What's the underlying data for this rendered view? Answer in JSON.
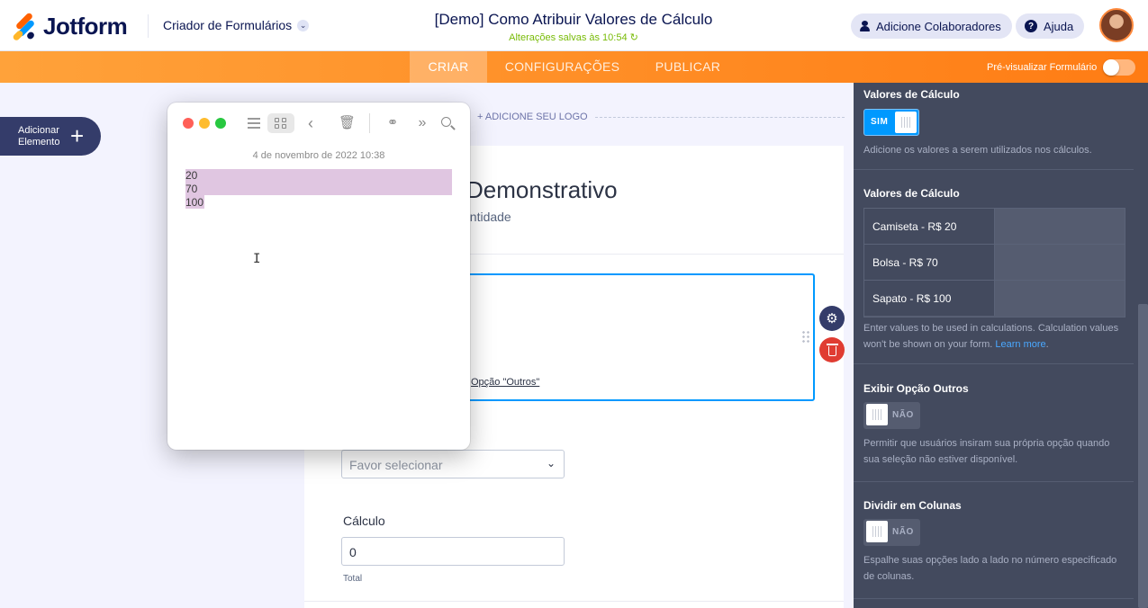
{
  "header": {
    "logo_text": "Jotform",
    "form_builder_label": "Criador de Formulários",
    "form_builder_chevron": "⌄",
    "title": "[Demo] Como Atribuir Valores de Cálculo",
    "saved_status": "Alterações salvas às 10:54 ↻",
    "collaborators_button": "Adicione Colaboradores",
    "help_button": "Ajuda",
    "help_glyph": "?"
  },
  "nav": {
    "tabs": [
      {
        "label": "CRIAR",
        "active": true
      },
      {
        "label": "CONFIGURAÇÕES",
        "active": false
      },
      {
        "label": "PUBLICAR",
        "active": false
      }
    ],
    "preview_label": "Pré-visualizar Formulário"
  },
  "left": {
    "add_element_label": "Adicionar Elemento",
    "add_element_plus": "+"
  },
  "form": {
    "add_logo": "+ ADICIONE SEU LOGO",
    "heading_partial": "Demonstrativo",
    "subheading_partial": "antidade",
    "other_option_link": "Opção \"Outros\"",
    "dropdown_placeholder": "Favor selecionar",
    "dropdown_chevron": "⌄",
    "calc_label": "Cálculo",
    "calc_value": "0",
    "calc_sublabel": "Total",
    "gear_glyph": "⚙"
  },
  "notes": {
    "date": "4 de novembro de 2022 10:38",
    "lines": [
      "20",
      "70",
      "100"
    ],
    "icons": {
      "back": "‹",
      "trash": "🗑",
      "share": "⚭",
      "more": "»"
    },
    "cursor": "I"
  },
  "panel": {
    "sec1_title": "Valores de Cálculo",
    "sec1_toggle": "SIM",
    "sec1_desc": "Adicione os valores a serem utilizados nos cálculos.",
    "sec2_title": "Valores de Cálculo",
    "calc_rows": [
      {
        "label": "Camiseta - R$ 20",
        "value": ""
      },
      {
        "label": "Bolsa - R$ 70",
        "value": ""
      },
      {
        "label": "Sapato - R$ 100",
        "value": ""
      }
    ],
    "sec2_desc": "Enter values to be used in calculations. Calculation values won't be shown on your form.",
    "sec2_link": "Learn more",
    "sec3_title": "Exibir Opção Outros",
    "sec3_toggle": "NÃO",
    "sec3_desc": "Permitir que usuários insiram sua própria opção quando sua seleção não estiver disponível.",
    "sec4_title": "Dividir em Colunas",
    "sec4_toggle": "NÃO",
    "sec4_desc": "Espalhe suas opções lado a lado no número especificado de colunas."
  },
  "colors": {
    "brand_orange": "#ff7c14",
    "accent_blue": "#0099ff",
    "panel_bg": "#434a5e",
    "danger": "#e03c32",
    "selection": "#e0c6e1"
  }
}
